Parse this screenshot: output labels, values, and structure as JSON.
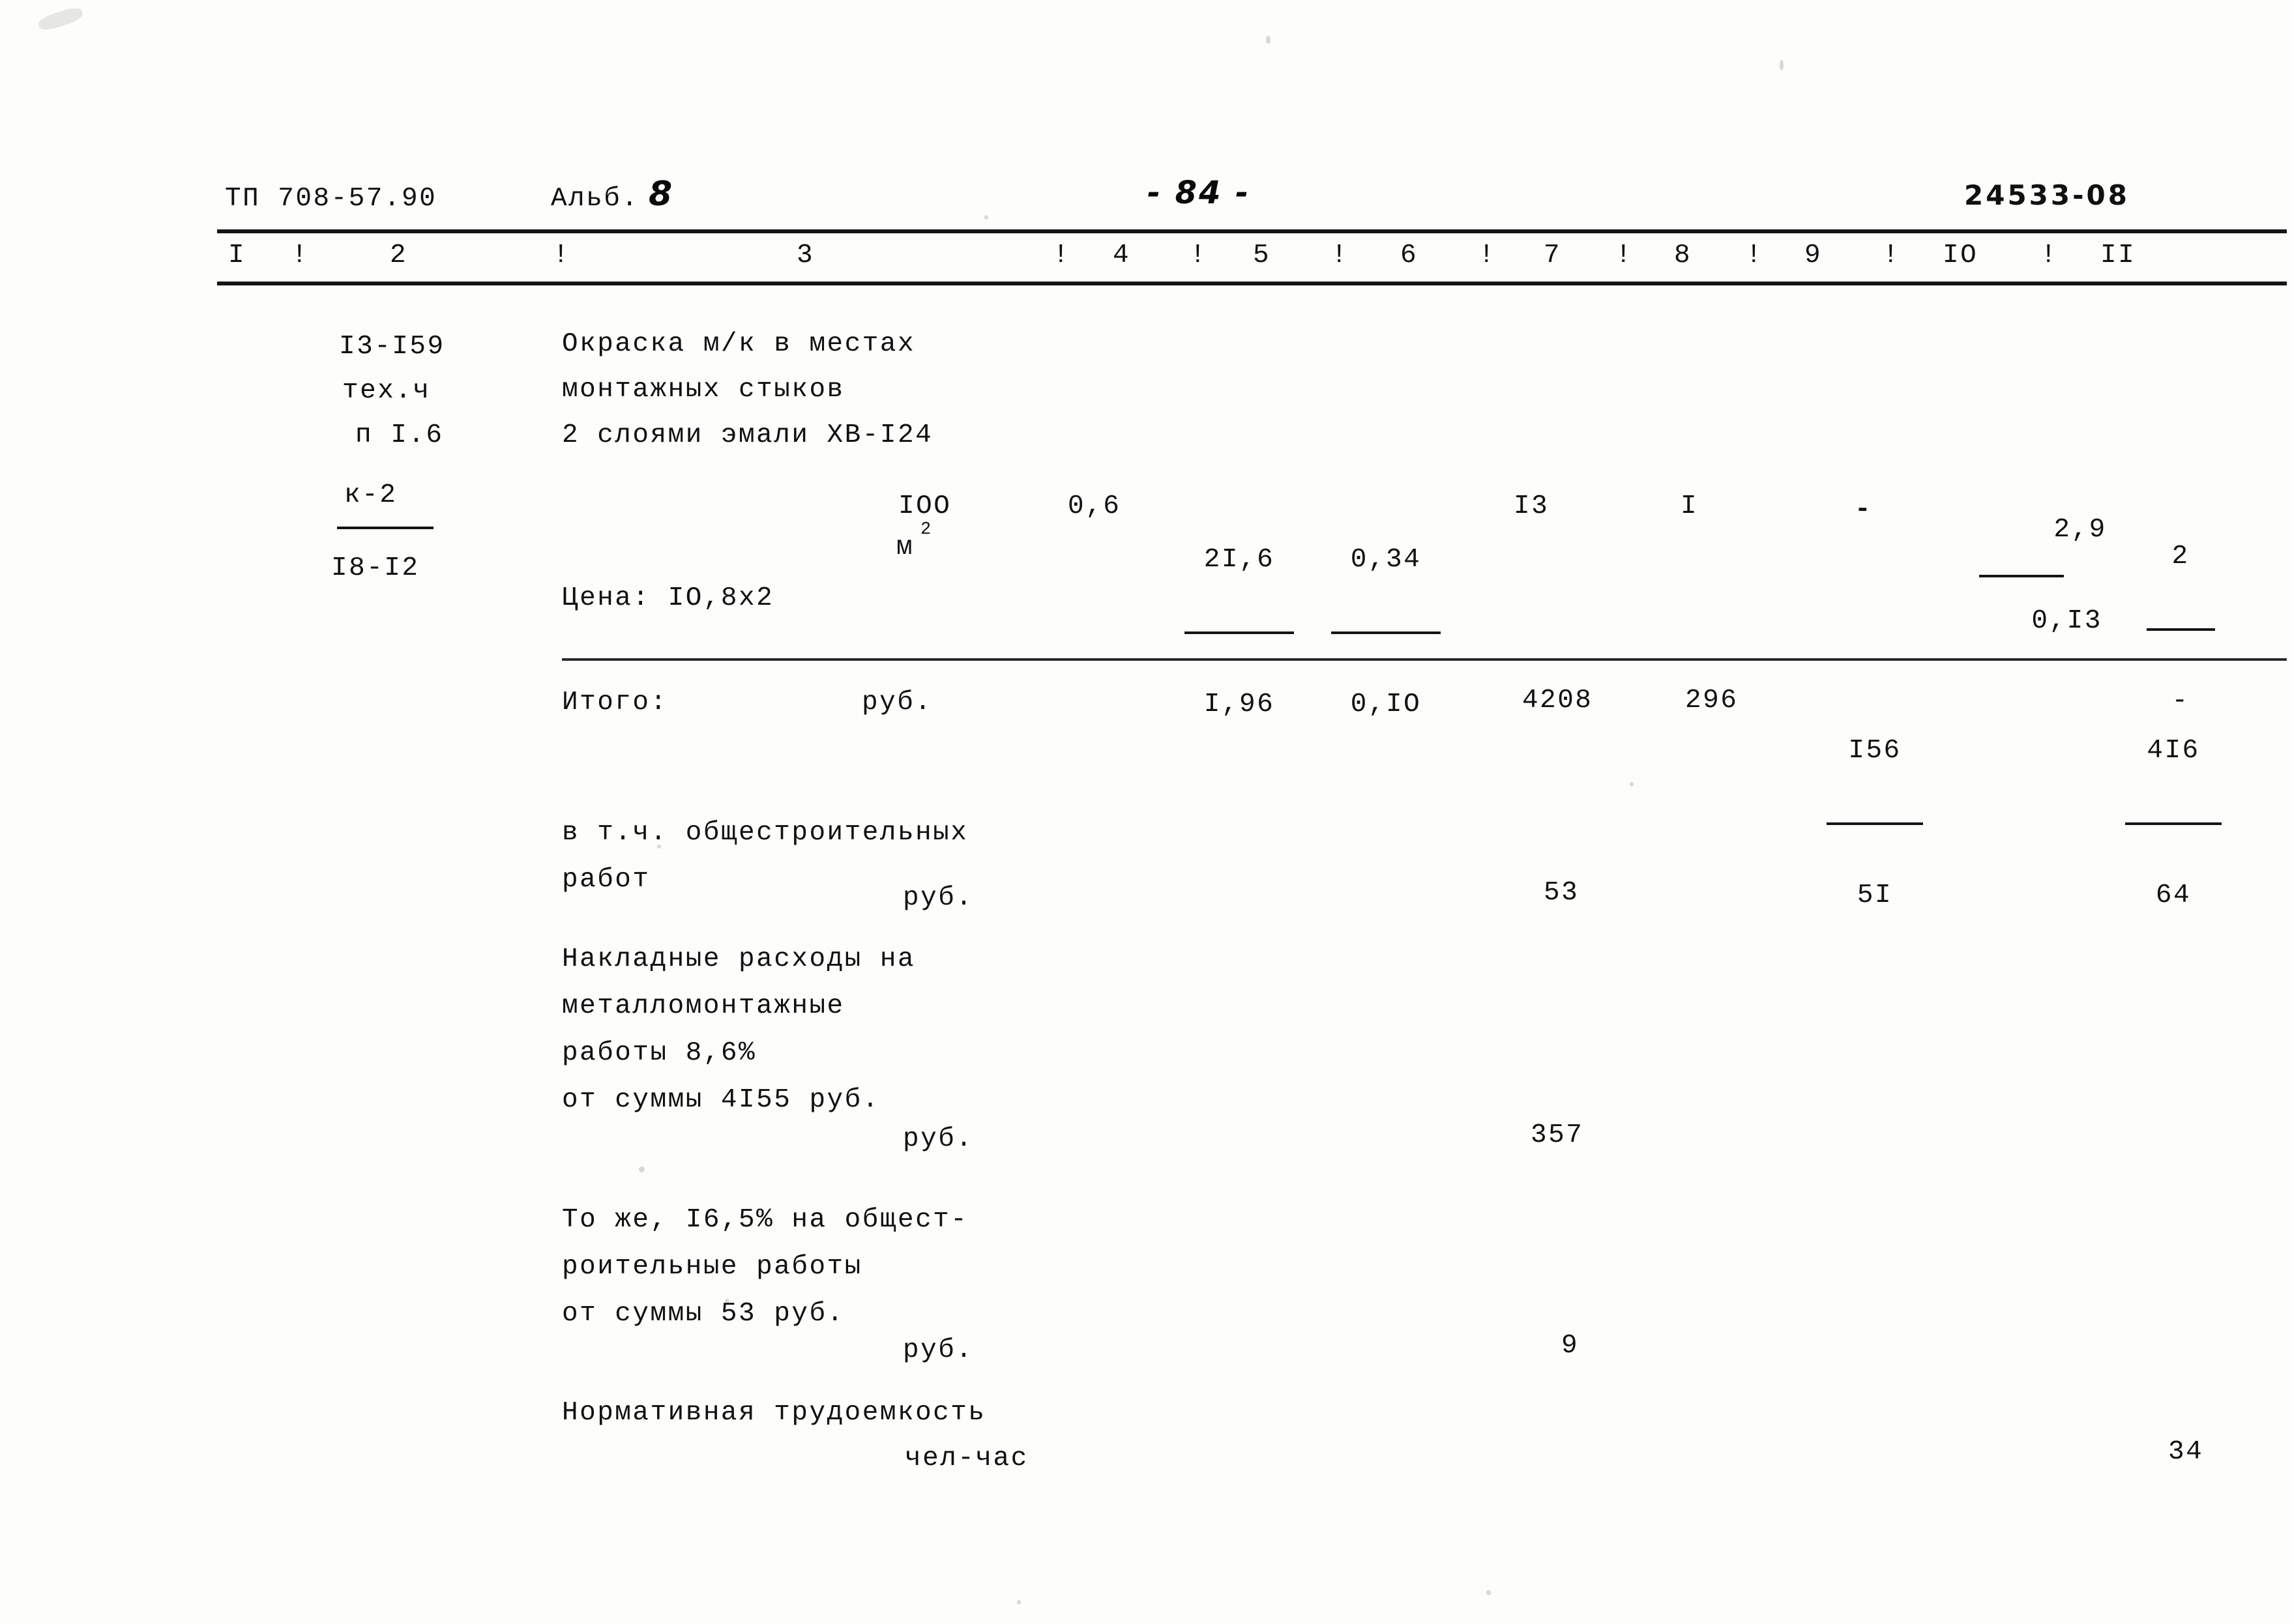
{
  "document": {
    "header": {
      "code": "ТП 708-57.90",
      "album_label": "Альб.",
      "album_number": "8",
      "page_number": "- 84 -",
      "stamp": "24533-08"
    },
    "column_ruler": {
      "separator": "!",
      "numbers": [
        "I",
        "2",
        "3",
        "4",
        "5",
        "6",
        "7",
        "8",
        "9",
        "IO",
        "II"
      ]
    },
    "main_row": {
      "ref_lines": [
        "I3-I59",
        "тех.ч",
        "п I.6"
      ],
      "ref_fraction": {
        "numerator": "к-2",
        "denominator": "I8-I2"
      },
      "description_lines": [
        "Окраска м/к в местах",
        "монтажных стыков",
        "2 слоями эмали ХВ-I24"
      ],
      "qty": "IOO",
      "unit": "м",
      "unit_exponent": "2",
      "col5": "0,6",
      "col6": {
        "numerator": "2I,6",
        "denominator": "I,96"
      },
      "col7": {
        "numerator": "0,34",
        "denominator": "0,IO"
      },
      "col8": "I3",
      "col9": "I",
      "col10": "-",
      "col11": {
        "numerator": "2,9",
        "denominator": "0,I3"
      },
      "col12": {
        "numerator": "2",
        "denominator": "-"
      },
      "price_note": "Цена: IO,8х2"
    },
    "totals_row": {
      "label": "Итого:",
      "unit": "руб.",
      "value_a": "4208",
      "value_b": "296",
      "fraction_a": {
        "numerator": "I56",
        "denominator": "5I"
      },
      "fraction_b": {
        "numerator": "4I6",
        "denominator": "64"
      }
    },
    "sections": [
      {
        "name": "general-construction-works",
        "lines": [
          "в т.ч. общестроительных",
          "работ"
        ],
        "unit": "руб.",
        "value": "53"
      },
      {
        "name": "overheads-metal-assembly",
        "lines": [
          "Накладные расходы на",
          "металломонтажные",
          "работы 8,6%",
          "от суммы 4I55 руб."
        ],
        "unit": "руб.",
        "value": "357"
      },
      {
        "name": "overheads-general-construction",
        "lines": [
          "То же, I6,5% на общест-",
          "роительные работы",
          "от суммы 53 руб."
        ],
        "unit": "руб.",
        "value": "9"
      },
      {
        "name": "normative-labor",
        "lines": [
          "Нормативная трудоемкость"
        ],
        "unit": "чел-час",
        "value": "34"
      }
    ]
  }
}
